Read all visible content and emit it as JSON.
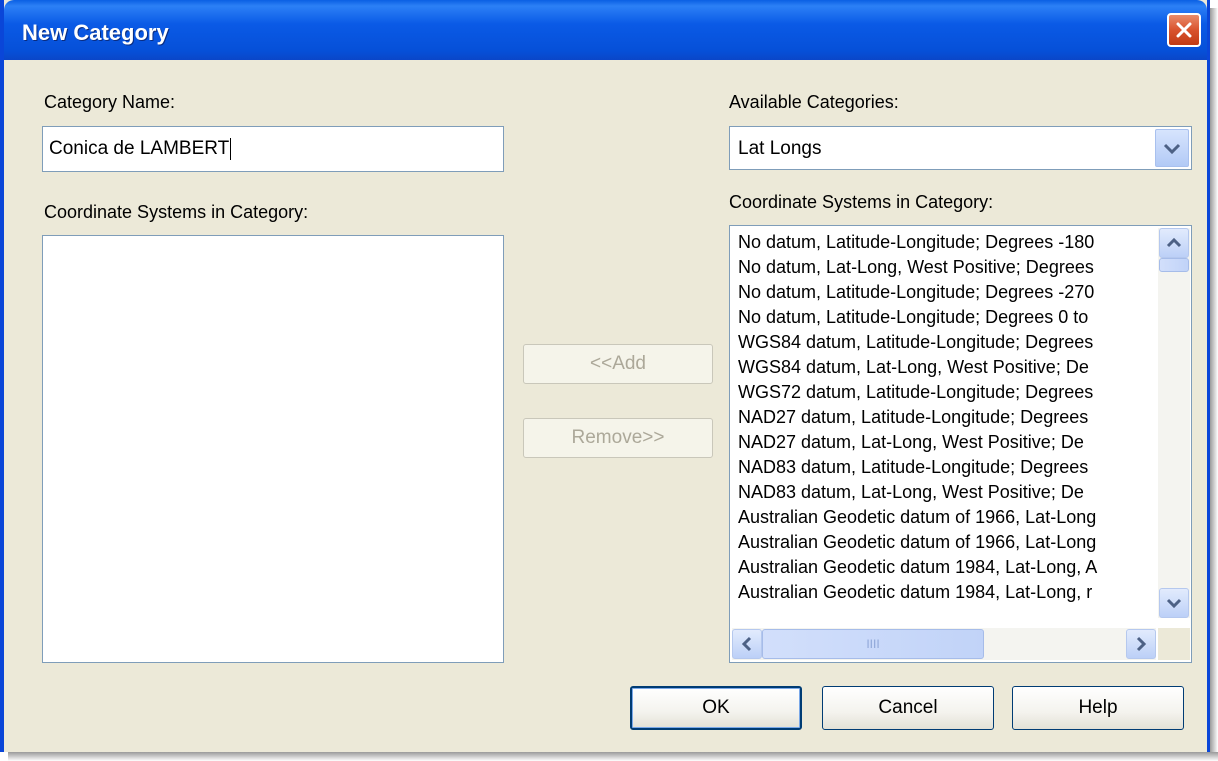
{
  "window": {
    "title": "New Category"
  },
  "left": {
    "category_name_label": "Category Name:",
    "category_name_value": "Conica de LAMBERT",
    "systems_label": "Coordinate Systems in Category:",
    "systems_items": []
  },
  "middle": {
    "add_label": "<<Add",
    "remove_label": "Remove>>"
  },
  "right": {
    "available_label": "Available Categories:",
    "available_selected": "Lat Longs",
    "systems_label": "Coordinate Systems in Category:",
    "systems_items": [
      "No datum, Latitude-Longitude; Degrees -180",
      "No datum, Lat-Long, West Positive; Degrees",
      "No datum, Latitude-Longitude; Degrees -270",
      "No datum, Latitude-Longitude; Degrees 0 to",
      "WGS84 datum, Latitude-Longitude; Degrees",
      "WGS84 datum, Lat-Long, West Positive; De",
      "WGS72 datum, Latitude-Longitude; Degrees",
      "NAD27 datum, Latitude-Longitude; Degrees",
      "NAD27 datum, Lat-Long, West Positive; De",
      "NAD83 datum, Latitude-Longitude; Degrees",
      "NAD83 datum, Lat-Long, West Positive; De",
      "Australian Geodetic datum of 1966, Lat-Long",
      "Australian Geodetic datum of 1966, Lat-Long",
      "Australian Geodetic datum 1984, Lat-Long, A",
      "Australian Geodetic datum 1984, Lat-Long, r"
    ],
    "hscroll_grip": "IIII"
  },
  "footer": {
    "ok_label": "OK",
    "cancel_label": "Cancel",
    "help_label": "Help"
  },
  "colors": {
    "titlebar": "#0a5ae6",
    "dialog_bg": "#ece9d8",
    "close_button": "#d9532d"
  }
}
